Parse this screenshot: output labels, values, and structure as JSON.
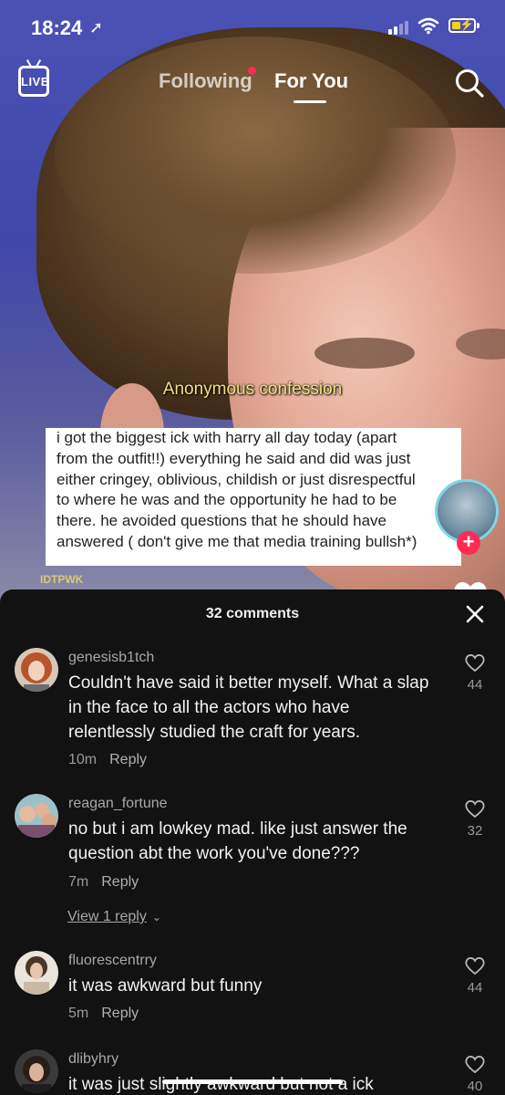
{
  "status_bar": {
    "time": "18:24",
    "location_glyph": "➚"
  },
  "top_nav": {
    "live_label": "LIVE",
    "following_label": "Following",
    "for_you_label": "For You"
  },
  "video": {
    "caption_title": "Anonymous confession",
    "confession_lines": [
      "i got the biggest ick with harry all day today (apart",
      "from the outfit!!) everything he said and did was just",
      "either cringey, oblivious, childish or just disrespectful",
      "to where he was and the opportunity he had to be",
      "there. he avoided questions that he should have",
      "answered ( don't give me that media training bullsh*)"
    ],
    "watermark": "IDTPWK",
    "follow_plus": "+"
  },
  "comments_sheet": {
    "title": "32 comments",
    "reply_label": "Reply",
    "comments": [
      {
        "username": "genesisb1tch",
        "lines": [
          "Couldn't have said it better myself. What a slap",
          "in the face to all the actors who have",
          "relentlessly studied the craft for years."
        ],
        "time": "10m",
        "likes": "44"
      },
      {
        "username": "reagan_fortune",
        "lines": [
          "no but i am lowkey mad. like just answer the",
          "question abt the work you've done???"
        ],
        "time": "7m",
        "likes": "32",
        "view_replies": "View 1 reply"
      },
      {
        "username": "fluorescentrry",
        "lines": [
          "it was awkward but funny"
        ],
        "time": "5m",
        "likes": "44"
      },
      {
        "username": "dlibyhry",
        "lines": [
          "it was just slightly awkward but not a ick"
        ],
        "likes": "40"
      }
    ]
  }
}
